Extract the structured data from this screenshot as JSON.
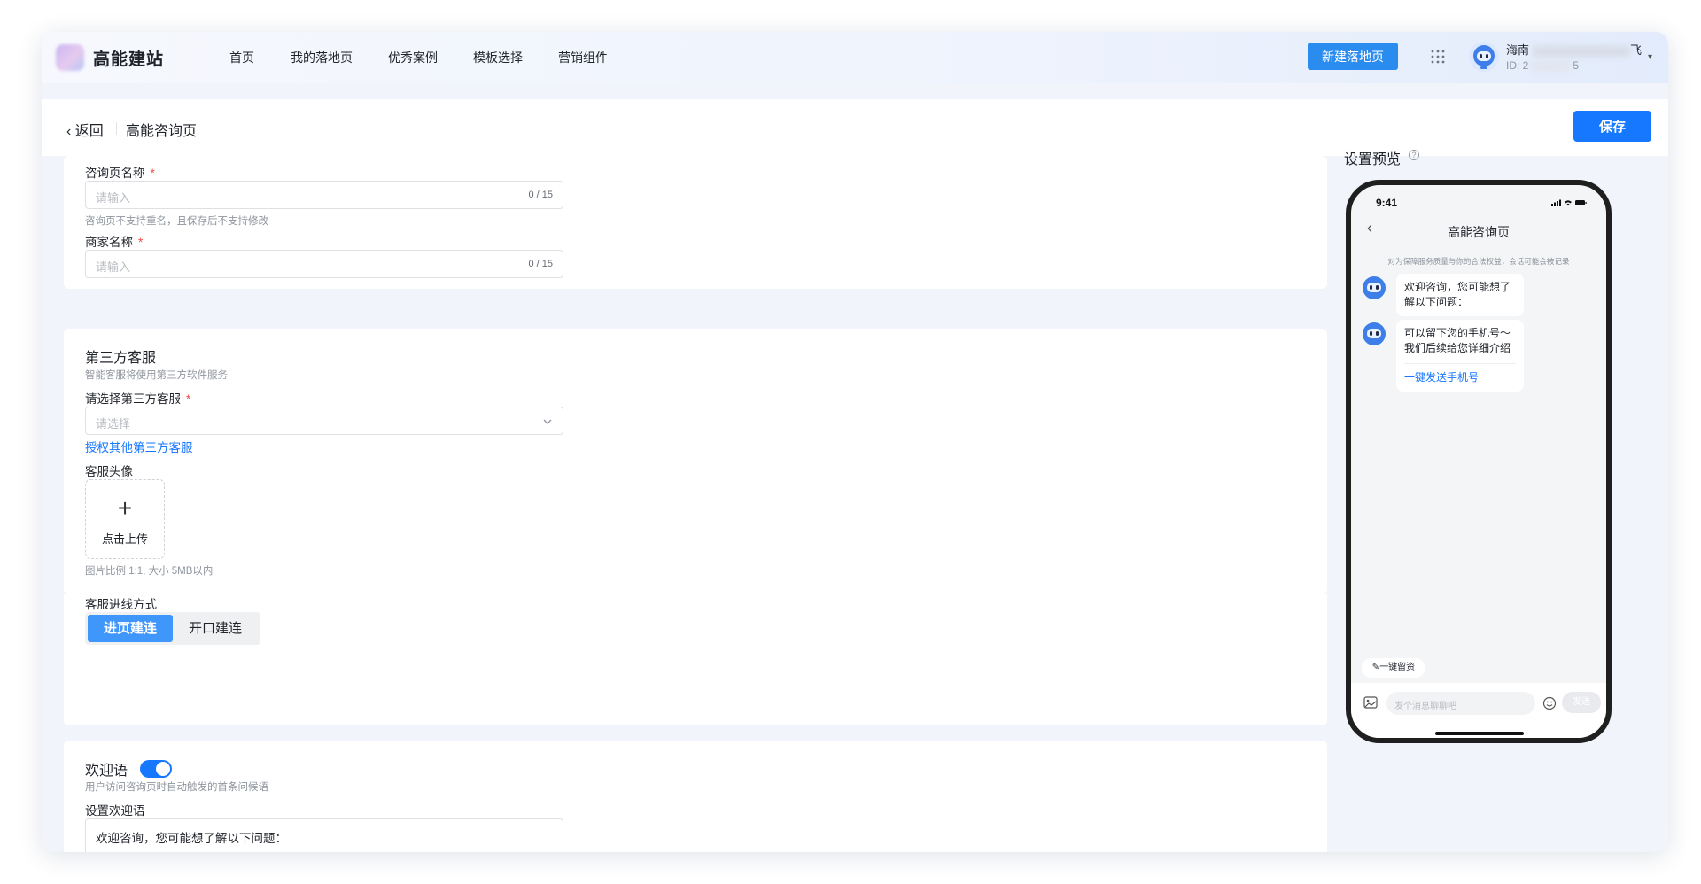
{
  "nav": {
    "brand": "高能建站",
    "items": [
      "首页",
      "我的落地页",
      "优秀案例",
      "模板选择",
      "营销组件"
    ],
    "new_button": "新建落地页",
    "user_name_prefix": "海南",
    "user_name_suffix": "飞",
    "user_id_prefix": "ID: 2",
    "user_id_suffix": "5"
  },
  "header": {
    "back": "返回",
    "title": "高能咨询页",
    "save": "保存"
  },
  "form": {
    "consult_name_label": "咨询页名称",
    "consult_name_placeholder": "请输入",
    "consult_name_count": "0 / 15",
    "consult_name_hint": "咨询页不支持重名，且保存后不支持修改",
    "merchant_label": "商家名称",
    "merchant_placeholder": "请输入",
    "merchant_count": "0 / 15",
    "third_party_title": "第三方客服",
    "third_party_desc": "智能客服将使用第三方软件服务",
    "select_label": "请选择第三方客服",
    "select_placeholder": "请选择",
    "authorize_link": "授权其他第三方客服",
    "avatar_label": "客服头像",
    "upload_text": "点击上传",
    "upload_hint": "图片比例 1:1, 大小 5MB以内",
    "connect_label": "客服进线方式",
    "connect_options": [
      "进页建连",
      "开口建连"
    ],
    "welcome_title": "欢迎语",
    "welcome_enabled": true,
    "welcome_desc": "用户访问咨询页时自动触发的首条问候语",
    "welcome_set_label": "设置欢迎语",
    "welcome_text": "欢迎咨询，您可能想了解以下问题："
  },
  "preview": {
    "label": "设置预览",
    "time": "9:41",
    "title": "高能咨询页",
    "notice": "对为保障服务质量与你的合法权益，会话可能会被记录",
    "msg1": "欢迎咨询，您可能想了解以下问题：",
    "msg2": "可以留下您的手机号～我们后续给您详细介绍",
    "msg2_link": "一键发送手机号",
    "leave_info": "一键留资",
    "input_placeholder": "发个消息聊聊吧",
    "send": "发送"
  },
  "colors": {
    "primary": "#1677ff",
    "new_button": "#2b8cf0",
    "segment_active": "#3f97fb",
    "required": "#f54a45"
  }
}
